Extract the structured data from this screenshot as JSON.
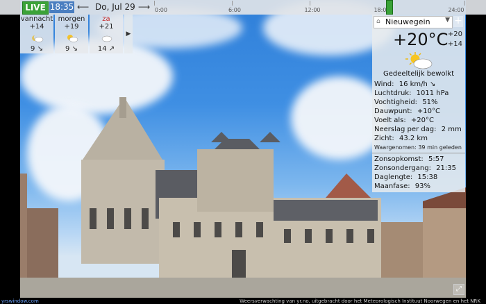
{
  "topbar": {
    "live_label": "LIVE",
    "time": "18:35",
    "prev_icon": "arrow-left-icon",
    "next_icon": "arrow-right-icon",
    "date": "Do, Jul 29",
    "timeline_ticks": [
      "0:00",
      "6:00",
      "12:00",
      "18:00",
      "24:00"
    ]
  },
  "forecast": [
    {
      "name": "vannacht",
      "temp": "+14",
      "icon": "moon-cloud-icon",
      "wind": "9 ↘",
      "highlight": false
    },
    {
      "name": "morgen",
      "temp": "+19",
      "icon": "sun-cloud-icon",
      "wind": "9 ↘",
      "highlight": false
    },
    {
      "name": "za",
      "temp": "+21",
      "icon": "cloud-icon",
      "wind": "14 ↗",
      "highlight": true
    }
  ],
  "forecast_more_icon": "chevron-right-icon",
  "panel": {
    "location": "Nieuwegein",
    "add_icon": "plus-icon",
    "temperature": "+20°C",
    "high": "+20",
    "low": "+14",
    "condition": "Gedeeltelijk bewolkt",
    "details": [
      {
        "label": "Wind:",
        "value": "16 km/h  ↘"
      },
      {
        "label": "Luchtdruk:",
        "value": "1011 hPa"
      },
      {
        "label": "Vochtigheid:",
        "value": "51%"
      },
      {
        "label": "Dauwpunt:",
        "value": "+10°C"
      },
      {
        "label": "Voelt als:",
        "value": "+20°C"
      },
      {
        "label": "Neerslag per dag:",
        "value": "2 mm"
      },
      {
        "label": "Zicht:",
        "value": "43.2 km"
      }
    ],
    "observed": "Waargenomen:  39 min geleden",
    "sun": [
      {
        "label": "Zonsopkomst:",
        "value": "5:57"
      },
      {
        "label": "Zonsondergang:",
        "value": "21:35"
      },
      {
        "label": "Daglengte:",
        "value": "15:38"
      },
      {
        "label": "Maanfase:",
        "value": "93%"
      }
    ]
  },
  "footer": {
    "left": "yrswindow.com",
    "right": "Weersverwachting van yr.no, uitgebracht door het Meteorologisch Instituut Noorwegen en het NRK"
  },
  "fullscreen_icon": "fullscreen-icon"
}
